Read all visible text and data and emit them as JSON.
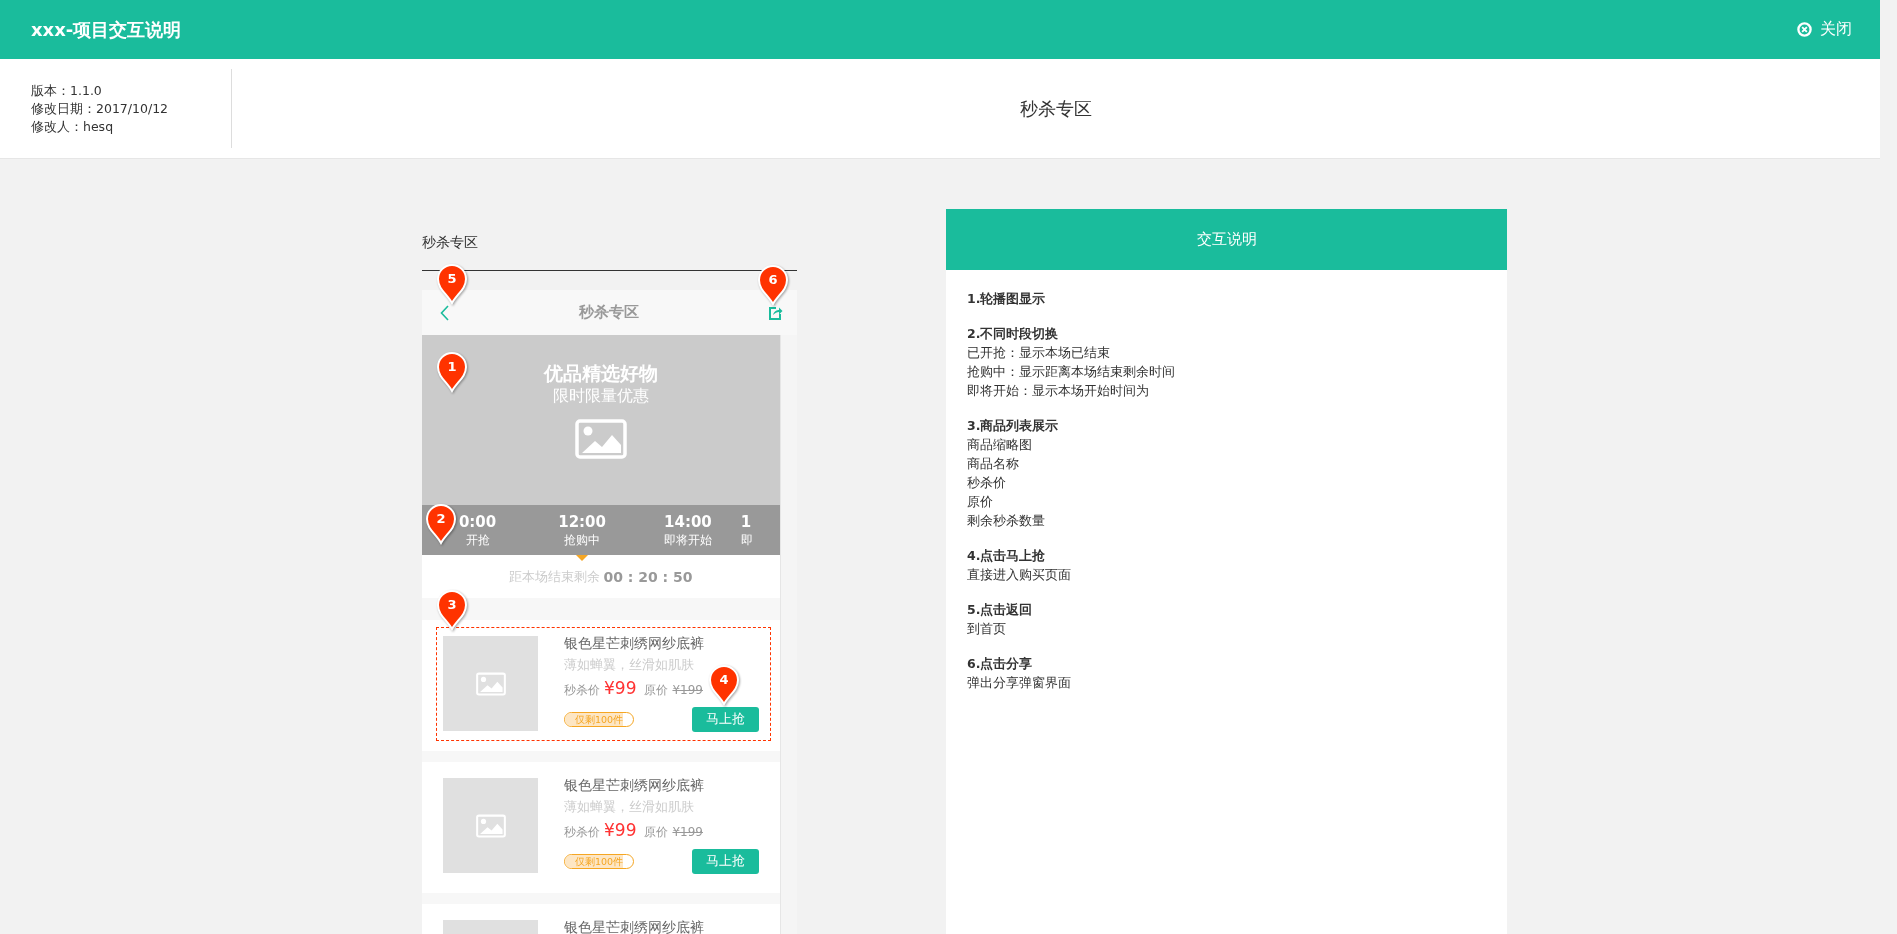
{
  "header": {
    "title": "xxx-项目交互说明",
    "close": "关闭"
  },
  "meta": [
    "版本：1.1.0",
    "修改日期：2017/10/12",
    "修改人：hesq"
  ],
  "page_title": "秒杀专区",
  "prototype": {
    "label": "秒杀专区",
    "nav": {
      "title": "秒杀专区",
      "back_marker": "5",
      "share_marker": "6"
    },
    "banner": {
      "title": "优品精选好物",
      "subtitle": "限时限量优惠",
      "marker": "1"
    },
    "time_tabs": {
      "marker": "2",
      "tabs": [
        {
          "time": "0:00",
          "label": "开抢",
          "selected": false
        },
        {
          "time": "12:00",
          "label": "抢购中",
          "selected": true
        },
        {
          "time": "14:00",
          "label": "即将开始",
          "selected": false
        },
        {
          "time": "1",
          "label": "即",
          "selected": false
        }
      ]
    },
    "countdown": {
      "label": "距本场结束剩余",
      "time": "00 : 20 : 50"
    },
    "products": [
      {
        "name": "银色星芒刺绣网纱底裤",
        "desc": "薄如蝉翼，丝滑如肌肤",
        "price_label": "秒杀价",
        "price": "¥99",
        "orig_label": "原价",
        "orig_price": "¥199",
        "stock": "仅剩100件",
        "level": 0.85,
        "button": "马上抢",
        "highlighted": true,
        "marker": "3",
        "button_marker": "4"
      },
      {
        "name": "银色星芒刺绣网纱底裤",
        "desc": "薄如蝉翼，丝滑如肌肤",
        "price_label": "秒杀价",
        "price": "¥99",
        "orig_label": "原价",
        "orig_price": "¥199",
        "stock": "仅剩100件",
        "level": 0.85,
        "button": "马上抢",
        "highlighted": false
      },
      {
        "name": "银色星芒刺绣网纱底裤",
        "highlighted": false
      }
    ]
  },
  "notes": {
    "title": "交互说明",
    "sections": [
      {
        "heading": "1.轮播图显示"
      },
      {
        "heading": "2.不同时段切换",
        "lines": [
          "已开抢：显示本场已结束",
          "抢购中：显示距离本场结束剩余时间",
          "即将开始：显示本场开始时间为"
        ]
      },
      {
        "heading": "3.商品列表展示",
        "lines": [
          "商品缩略图",
          "商品名称",
          "秒杀价",
          "原价",
          "剩余秒杀数量"
        ]
      },
      {
        "heading": "4.点击马上抢",
        "lines": [
          "直接进入购买页面"
        ]
      },
      {
        "heading": "5.点击返回",
        "lines": [
          "到首页"
        ]
      },
      {
        "heading": "6.点击分享",
        "lines": [
          "弹出分享弹窗界面"
        ]
      }
    ]
  }
}
